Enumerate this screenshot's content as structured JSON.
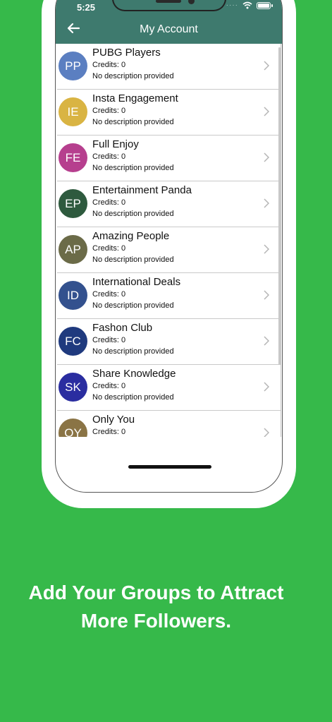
{
  "status": {
    "time": "5:25",
    "signal": "····"
  },
  "header": {
    "title": "My Account"
  },
  "colors": {
    "background": "#36b94a",
    "header": "#3e7a6e"
  },
  "icons": {
    "back": "arrow-left-icon",
    "chevron": "chevron-right-icon",
    "wifi": "wifi-icon",
    "battery": "battery-icon"
  },
  "groups": [
    {
      "initials": "PP",
      "title": "PUBG Players",
      "credits": "Credits: 0",
      "description": "No description provided",
      "color": "#5b7fc1"
    },
    {
      "initials": "IE",
      "title": "Insta Engagement",
      "credits": "Credits: 0",
      "description": "No description provided",
      "color": "#d9b443"
    },
    {
      "initials": "FE",
      "title": "Full Enjoy",
      "credits": "Credits: 0",
      "description": "No description provided",
      "color": "#b63f8e"
    },
    {
      "initials": "EP",
      "title": "Entertainment Panda",
      "credits": "Credits: 0",
      "description": "No description provided",
      "color": "#2e5a3e"
    },
    {
      "initials": "AP",
      "title": "Amazing People",
      "credits": "Credits: 0",
      "description": "No description provided",
      "color": "#6b6b48"
    },
    {
      "initials": "ID",
      "title": "International Deals",
      "credits": "Credits: 0",
      "description": "No description provided",
      "color": "#33518e"
    },
    {
      "initials": "FC",
      "title": "Fashon Club",
      "credits": "Credits: 0",
      "description": "No description provided",
      "color": "#1f3a7e"
    },
    {
      "initials": "SK",
      "title": "Share Knowledge",
      "credits": "Credits: 0",
      "description": "No description provided",
      "color": "#2a2da0"
    },
    {
      "initials": "OY",
      "title": "Only You",
      "credits": "Credits: 0",
      "description": "",
      "color": "#8a7445"
    }
  ],
  "caption": {
    "line1": "Add Your Groups to Attract",
    "line2": "More Followers."
  }
}
